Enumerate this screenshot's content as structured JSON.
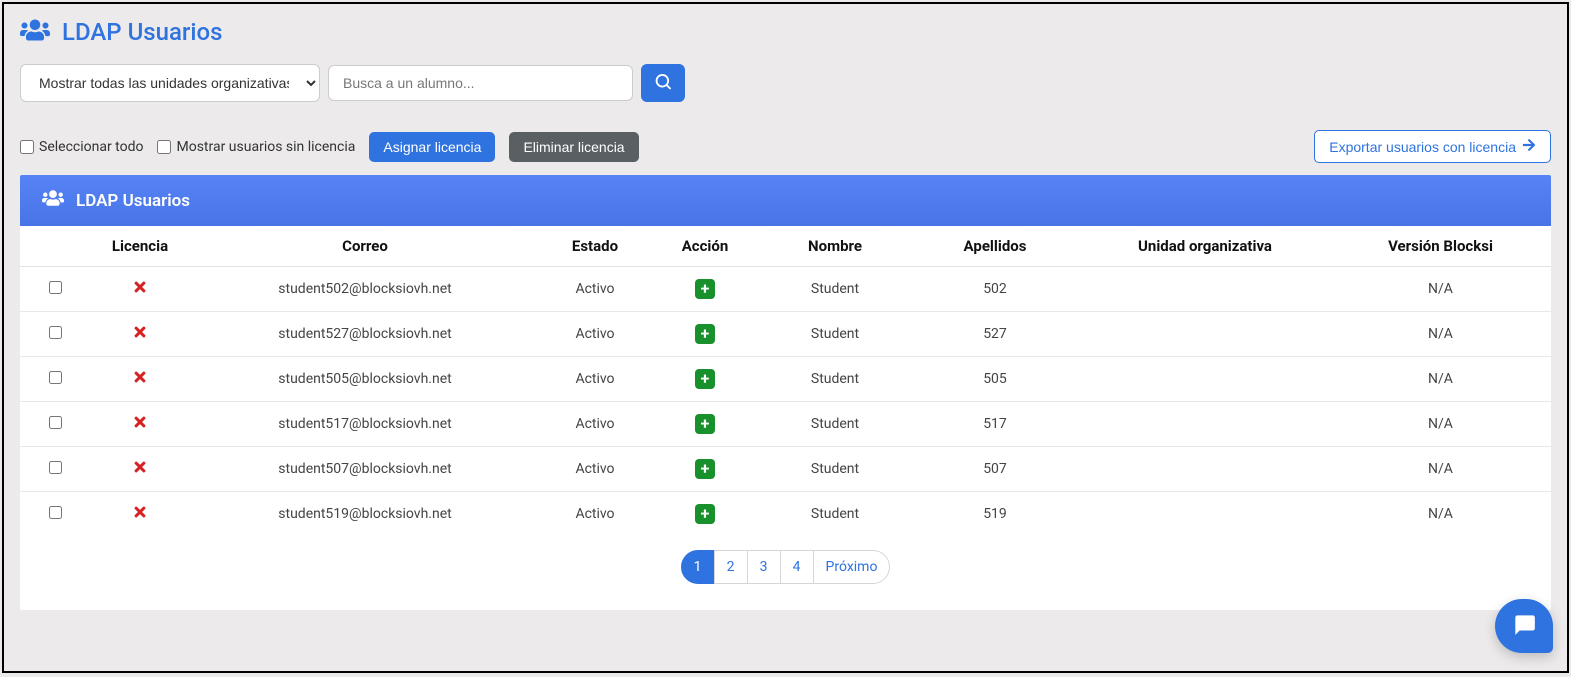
{
  "page": {
    "title": "LDAP Usuarios"
  },
  "filter": {
    "ou_select_label": "Mostrar todas las unidades organizativas",
    "search_placeholder": "Busca a un alumno..."
  },
  "toolbar": {
    "select_all_label": "Seleccionar todo",
    "show_unlicensed_label": "Mostrar usuarios sin licencia",
    "assign_license_label": "Asignar licencia",
    "remove_license_label": "Eliminar licencia",
    "export_label": "Exportar usuarios con licencia"
  },
  "panel": {
    "title": "LDAP Usuarios"
  },
  "table": {
    "headers": {
      "licencia": "Licencia",
      "correo": "Correo",
      "estado": "Estado",
      "accion": "Acción",
      "nombre": "Nombre",
      "apellidos": "Apellidos",
      "unidad": "Unidad organizativa",
      "version": "Versión Blocksi"
    },
    "rows": [
      {
        "email": "student502@blocksiovh.net",
        "estado": "Activo",
        "nombre": "Student",
        "apellidos": "502",
        "ou": "",
        "version": "N/A"
      },
      {
        "email": "student527@blocksiovh.net",
        "estado": "Activo",
        "nombre": "Student",
        "apellidos": "527",
        "ou": "",
        "version": "N/A"
      },
      {
        "email": "student505@blocksiovh.net",
        "estado": "Activo",
        "nombre": "Student",
        "apellidos": "505",
        "ou": "",
        "version": "N/A"
      },
      {
        "email": "student517@blocksiovh.net",
        "estado": "Activo",
        "nombre": "Student",
        "apellidos": "517",
        "ou": "",
        "version": "N/A"
      },
      {
        "email": "student507@blocksiovh.net",
        "estado": "Activo",
        "nombre": "Student",
        "apellidos": "507",
        "ou": "",
        "version": "N/A"
      },
      {
        "email": "student519@blocksiovh.net",
        "estado": "Activo",
        "nombre": "Student",
        "apellidos": "519",
        "ou": "",
        "version": "N/A"
      }
    ]
  },
  "pagination": {
    "pages": [
      "1",
      "2",
      "3",
      "4"
    ],
    "active": "1",
    "next_label": "Próximo"
  }
}
